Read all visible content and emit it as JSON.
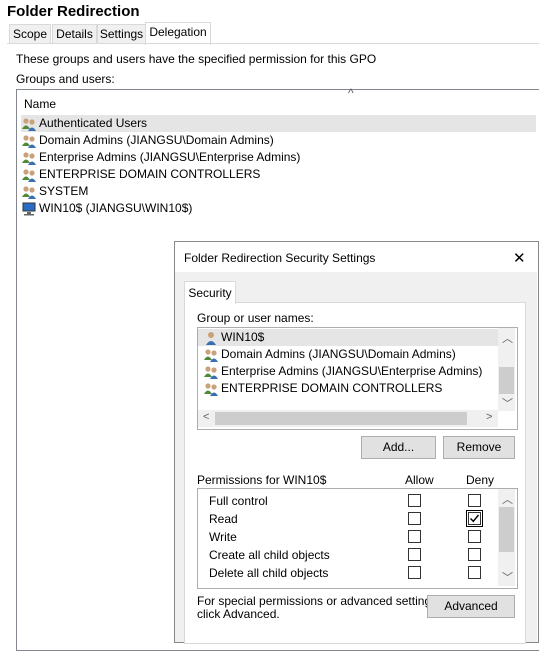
{
  "window": {
    "title": "Folder Redirection",
    "tabs": [
      "Scope",
      "Details",
      "Settings",
      "Delegation"
    ],
    "active_tab": "Delegation"
  },
  "delegation": {
    "description": "These groups and users have the specified permission for this GPO",
    "groups_label": "Groups and users:",
    "name_header": "Name",
    "rows": [
      {
        "label": "Authenticated Users",
        "icon": "group-icon"
      },
      {
        "label": "Domain Admins (JIANGSU\\Domain Admins)",
        "icon": "group-icon"
      },
      {
        "label": "Enterprise Admins (JIANGSU\\Enterprise Admins)",
        "icon": "group-icon"
      },
      {
        "label": "ENTERPRISE DOMAIN CONTROLLERS",
        "icon": "group-icon"
      },
      {
        "label": "SYSTEM",
        "icon": "group-icon"
      },
      {
        "label": "WIN10$ (JIANGSU\\WIN10$)",
        "icon": "computer-icon"
      }
    ]
  },
  "dialog": {
    "title": "Folder Redirection Security Settings",
    "close_glyph": "✕",
    "tab": "Security",
    "group_label": "Group or user names:",
    "users": [
      {
        "label": "WIN10$",
        "icon": "user-icon"
      },
      {
        "label": "Domain Admins (JIANGSU\\Domain Admins)",
        "icon": "group-icon"
      },
      {
        "label": "Enterprise Admins (JIANGSU\\Enterprise Admins)",
        "icon": "group-icon"
      },
      {
        "label": "ENTERPRISE DOMAIN CONTROLLERS",
        "icon": "group-icon"
      }
    ],
    "add_button": "Add...",
    "remove_button": "Remove",
    "permissions_label": "Permissions for WIN10$",
    "allow_header": "Allow",
    "deny_header": "Deny",
    "permissions": [
      {
        "name": "Full control",
        "allow": false,
        "deny": false
      },
      {
        "name": "Read",
        "allow": false,
        "deny": true
      },
      {
        "name": "Write",
        "allow": false,
        "deny": false
      },
      {
        "name": "Create all child objects",
        "allow": false,
        "deny": false
      },
      {
        "name": "Delete all child objects",
        "allow": false,
        "deny": false
      }
    ],
    "advanced_text_1": "For special permissions or advanced settings,",
    "advanced_text_2": "click Advanced.",
    "advanced_button": "Advanced"
  },
  "colors": {
    "selection": "#e5e5e5",
    "panel": "#f0f0f0",
    "border": "#adadad"
  }
}
